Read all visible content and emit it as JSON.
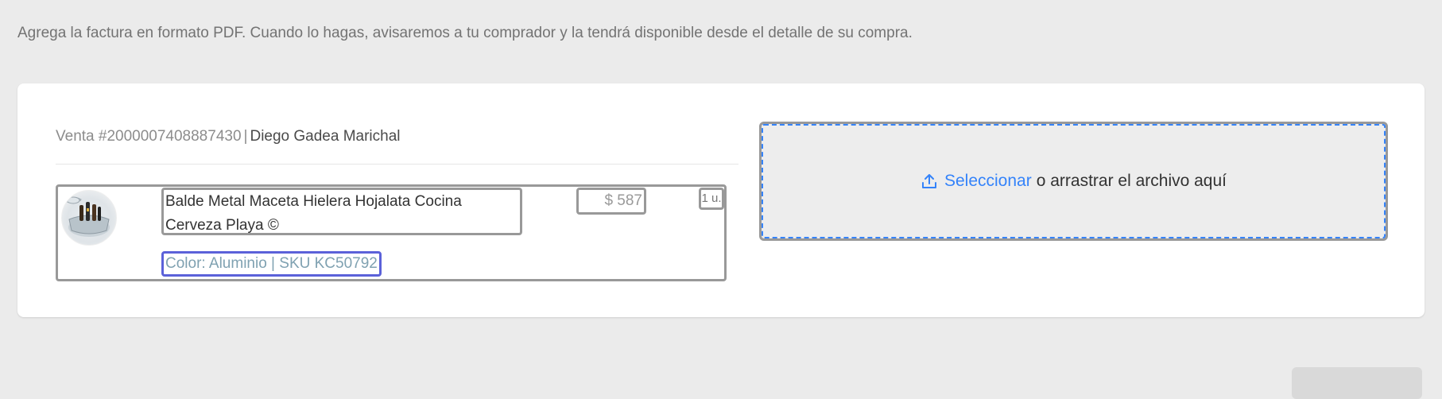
{
  "intro": {
    "text": "Agrega la factura en formato PDF. Cuando lo hagas, avisaremos a tu comprador y la tendrá disponible desde el detalle de su compra."
  },
  "sale": {
    "number_label": "Venta #2000007408887430",
    "separator": "|",
    "buyer": "Diego Gadea Marichal"
  },
  "item": {
    "title": "Balde Metal Maceta Hielera Hojalata Cocina Cerveza Playa ©",
    "attributes": "Color: Aluminio | SKU KC50792",
    "price": "$ 587",
    "quantity": "1 u.",
    "image_icon": "product-thumbnail"
  },
  "upload": {
    "icon": "upload-icon",
    "select_label": "Seleccionar",
    "drag_label": "o arrastrar el archivo aquí"
  },
  "colors": {
    "background": "#ebebeb",
    "card": "#ffffff",
    "accent": "#3483fa",
    "highlight_border": "#5b61d9",
    "annotation_border": "#999999"
  }
}
